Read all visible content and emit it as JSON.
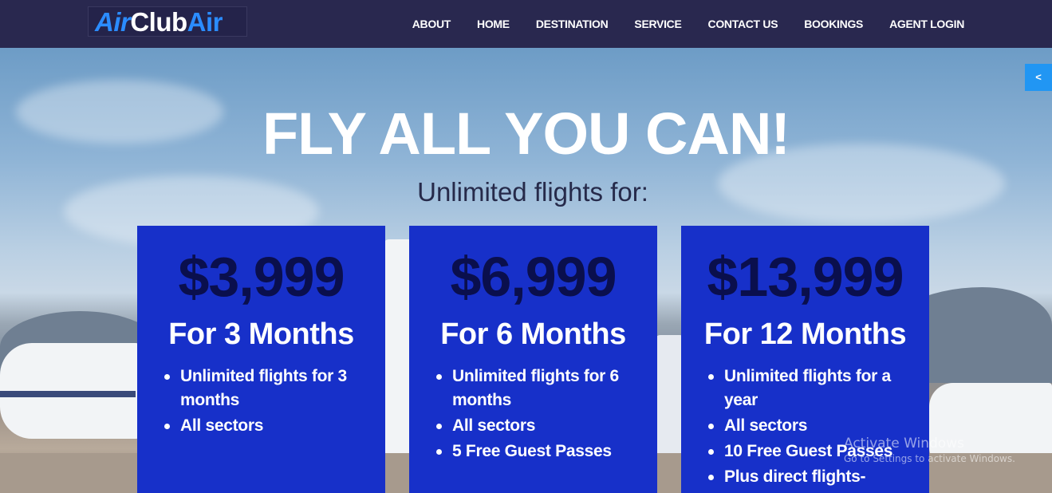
{
  "brand": {
    "part1": "Air",
    "part2": "Club",
    "part3": "Air"
  },
  "nav": [
    {
      "label": "ABOUT"
    },
    {
      "label": "HOME"
    },
    {
      "label": "DESTINATION"
    },
    {
      "label": "SERVICE"
    },
    {
      "label": "CONTACT US"
    },
    {
      "label": "BOOKINGS"
    },
    {
      "label": "AGENT LOGIN"
    }
  ],
  "side_tab": {
    "label": "<"
  },
  "hero": {
    "headline": "FLY ALL YOU CAN!",
    "subhead": "Unlimited flights for:"
  },
  "plans": [
    {
      "price": "$3,999",
      "duration": "For 3 Months",
      "features": [
        "Unlimited flights for 3 months",
        "All sectors"
      ]
    },
    {
      "price": "$6,999",
      "duration": "For 6 Months",
      "features": [
        "Unlimited flights for 6 months",
        "All sectors",
        "5 Free Guest Passes"
      ]
    },
    {
      "price": "$13,999",
      "duration": "For 12 Months",
      "features": [
        "Unlimited flights for a year",
        "All sectors",
        "10 Free Guest Passes",
        "Plus direct flights-"
      ]
    }
  ],
  "watermark": {
    "line1": "Activate Windows",
    "line2": "Go to Settings to activate Windows."
  },
  "colors": {
    "nav_bg": "#29284f",
    "card_bg": "#1730c9",
    "price_text": "#0a0f4d",
    "accent": "#2b8cff"
  }
}
